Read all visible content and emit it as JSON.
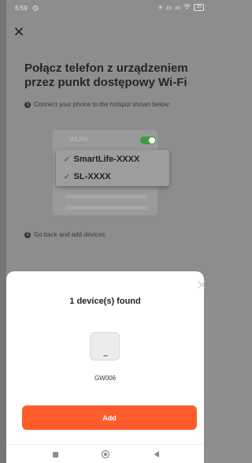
{
  "status_bar": {
    "time": "6:59",
    "alarm_icon": "alarm-clock-icon",
    "signal_text": "✳ .ııı .ııı",
    "battery": "35"
  },
  "header": {
    "close_icon": "close-icon",
    "title": "Połącz telefon z urządzeniem przez punkt dostępowy Wi-Fi"
  },
  "steps": [
    {
      "number": "1",
      "text": "Connect your phone to the hotspot shown below:"
    },
    {
      "number": "2",
      "text": "Go back and add devices."
    }
  ],
  "illustration": {
    "wlan_label": "WLAN",
    "networks": [
      "SmartLife-XXXX",
      "SL-XXXX"
    ]
  },
  "sheet": {
    "found_text": "1 device(s) found",
    "device_name": "GW006",
    "add_label": "Add"
  },
  "colors": {
    "accent": "#ff5c2b",
    "toggle_on": "#3e9a3f",
    "check": "#2e5a95"
  },
  "navbar": {
    "icons": [
      "recent-apps-icon",
      "home-icon",
      "back-icon"
    ]
  }
}
